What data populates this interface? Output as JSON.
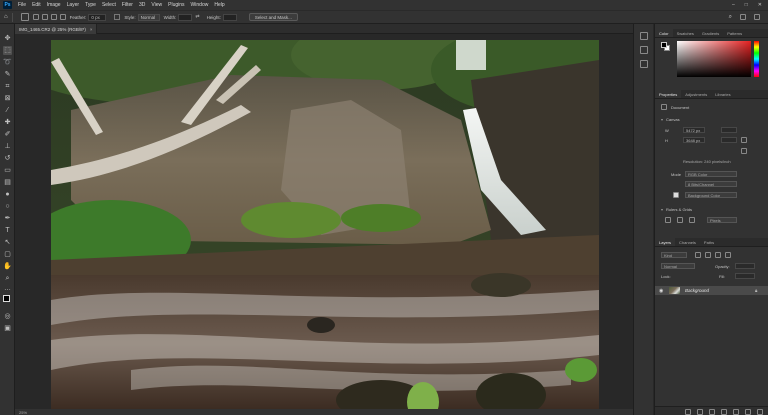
{
  "menu": {
    "logo": "Ps",
    "items": [
      "File",
      "Edit",
      "Image",
      "Layer",
      "Type",
      "Select",
      "Filter",
      "3D",
      "View",
      "Plugins",
      "Window",
      "Help"
    ],
    "window_controls": [
      "–",
      "□",
      "✕"
    ]
  },
  "options": {
    "feather_label": "Feather:",
    "feather_value": "0 px",
    "style_label": "Style:",
    "style_value": "Normal",
    "width_label": "Width:",
    "height_label": "Height:",
    "select_mask_button": "Select and Mask..."
  },
  "document": {
    "tab_title": "IMG_1465.CR2 @ 25% (RGB/8*)",
    "tab_close": "×",
    "status": "25%"
  },
  "panels": {
    "color_tabs": [
      "Color",
      "Swatches",
      "Gradients",
      "Patterns"
    ],
    "properties_tabs": [
      "Properties",
      "Adjustments",
      "Libraries"
    ],
    "document_label": "Document",
    "canvas_section": "Canvas",
    "width_label": "W",
    "width_value": "5472 px",
    "height_label": "H",
    "height_value": "3648 px",
    "resolution_text": "Resolution: 240 pixels/inch",
    "mode_label": "Mode",
    "mode_value": "RGB Color",
    "depth_value": "8 Bits/Channel",
    "fill_value": "Background Color",
    "rulers_section": "Rulers & Grids",
    "units_value": "Pixels",
    "layers_tabs": [
      "Layers",
      "Channels",
      "Paths"
    ],
    "kind_label": "Kind",
    "blend_value": "Normal",
    "opacity_label": "Opacity:",
    "lock_label": "Lock:",
    "fill_label": "Fill:",
    "layer_name": "Background"
  },
  "colors": {
    "accent": "#31a8ff",
    "panel_bg": "#323232",
    "app_bg": "#282828"
  }
}
